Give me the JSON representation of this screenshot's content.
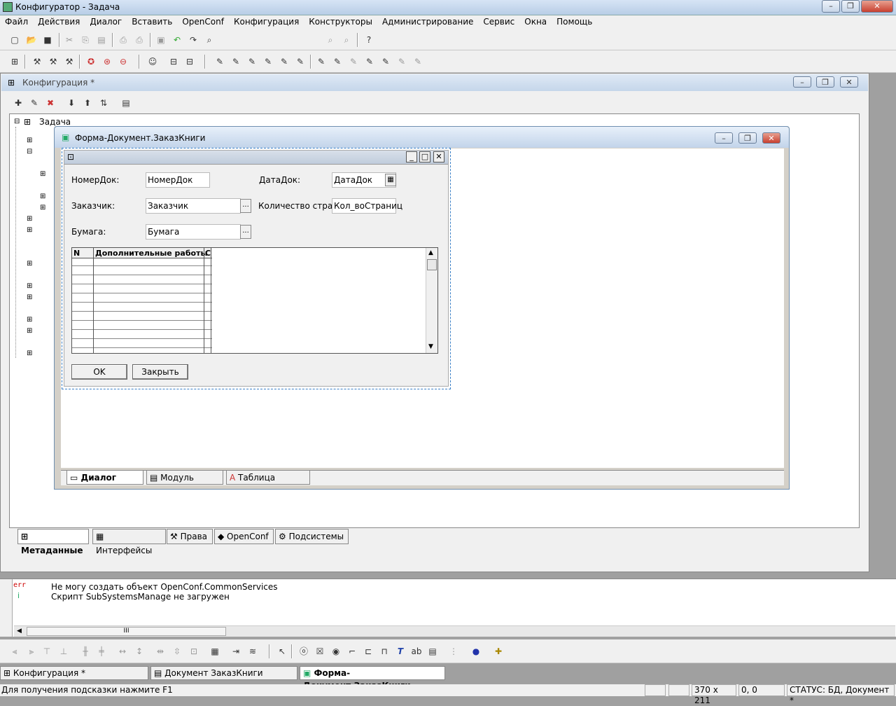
{
  "app": {
    "title": "Конфигуратор - Задача"
  },
  "menu": [
    "Файл",
    "Действия",
    "Диалог",
    "Вставить",
    "OpenConf",
    "Конфигурация",
    "Конструкторы",
    "Администрирование",
    "Сервис",
    "Окна",
    "Помощь"
  ],
  "config": {
    "title": "Конфигурация *",
    "tree_root": "Задача",
    "tabs": [
      "Метаданные",
      "Интерфейсы",
      "Права",
      "OpenConf",
      "Подсистемы"
    ]
  },
  "form": {
    "title": "Форма-Документ.ЗаказКниги",
    "labels": {
      "nomer": "НомерДок:",
      "data": "ДатаДок:",
      "zakazchik": "Заказчик:",
      "kolvo": "Количество страниц:",
      "bumaga": "Бумага:"
    },
    "values": {
      "nomer": "НомерДок",
      "data": "ДатаДок",
      "zakazchik": "Заказчик",
      "kolvo": "Кол_воСтраниц",
      "bumaga": "Бумага"
    },
    "grid": {
      "columns": [
        "N",
        "Дополнительные работы",
        "С"
      ]
    },
    "buttons": {
      "ok": "OK",
      "close": "Закрыть"
    },
    "tabs": [
      "Диалог",
      "Модуль",
      "Таблица"
    ]
  },
  "messages": [
    {
      "type": "err",
      "text": "Не   могу создать объект  OpenConf.CommonServices"
    },
    {
      "type": "info",
      "text": "Скрипт   SubSystemsManage      не загружен"
    }
  ],
  "hscroll": "III",
  "tasks": [
    "Конфигурация *",
    "Документ ЗаказКниги",
    "Форма-Документ.ЗаказКниги"
  ],
  "status": {
    "hint": "Для получения подсказки нажмите F1",
    "size": "370 x 211",
    "pos": "0, 0",
    "state": "СТАТУС: БД, Документ *"
  }
}
